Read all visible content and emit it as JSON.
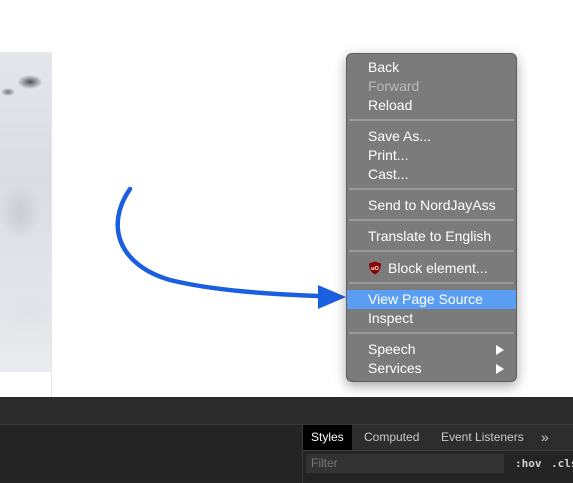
{
  "context_menu": {
    "items": [
      {
        "label": "Back",
        "disabled": false
      },
      {
        "label": "Forward",
        "disabled": true
      },
      {
        "label": "Reload",
        "disabled": false
      },
      {
        "label": "Save As..."
      },
      {
        "label": "Print..."
      },
      {
        "label": "Cast..."
      },
      {
        "label": "Send to NordJayAss"
      },
      {
        "label": "Translate to English"
      },
      {
        "label": "Block element..."
      },
      {
        "label": "View Page Source",
        "highlighted": true
      },
      {
        "label": "Inspect"
      },
      {
        "label": "Speech"
      },
      {
        "label": "Services"
      }
    ]
  },
  "devtools": {
    "tabs": {
      "styles": "Styles",
      "computed": "Computed",
      "event_listeners": "Event Listeners",
      "more": "»"
    },
    "filter_placeholder": "Filter",
    "hov_label": ":hov",
    "cls_label": ".cls"
  },
  "colors": {
    "menu_background": "#7b7b7b",
    "menu_highlight": "#5a9ef4",
    "arrow": "#1a5fe0",
    "devtools_background": "#242424",
    "ublock_icon": "#8b0000"
  },
  "icons": {
    "ublock": "ublock-origin-icon",
    "submenu": "chevron-right-icon"
  }
}
